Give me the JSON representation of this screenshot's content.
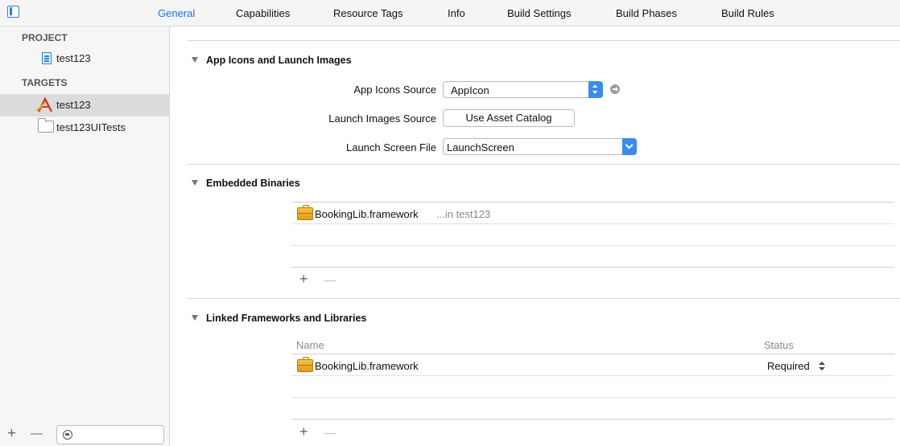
{
  "tabs": {
    "general": "General",
    "capabilities": "Capabilities",
    "resource_tags": "Resource Tags",
    "info": "Info",
    "build_settings": "Build Settings",
    "build_phases": "Build Phases",
    "build_rules": "Build Rules",
    "active": "general"
  },
  "sidebar": {
    "project_header": "PROJECT",
    "project_item": "test123",
    "targets_header": "TARGETS",
    "target_app": "test123",
    "target_tests": "test123UITests"
  },
  "app_icons": {
    "title": "App Icons and Launch Images",
    "app_icons_source_label": "App Icons Source",
    "app_icons_source_value": "AppIcon",
    "launch_images_source_label": "Launch Images Source",
    "use_asset_catalog_label": "Use Asset Catalog",
    "launch_screen_file_label": "Launch Screen File",
    "launch_screen_file_value": "LaunchScreen"
  },
  "embedded_binaries": {
    "title": "Embedded Binaries",
    "item_name": "BookingLib.framework",
    "item_location": "...in test123"
  },
  "linked_frameworks": {
    "title": "Linked Frameworks and Libraries",
    "col_name": "Name",
    "col_status": "Status",
    "item_name": "BookingLib.framework",
    "item_status": "Required"
  },
  "controls": {
    "plus": "+",
    "minus": "—"
  }
}
